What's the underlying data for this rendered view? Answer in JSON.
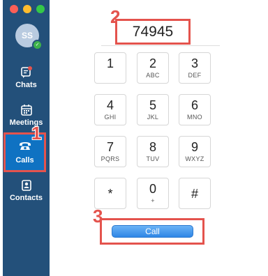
{
  "sidebar": {
    "avatar_initials": "SS",
    "items": [
      {
        "id": "chats",
        "label": "Chats",
        "icon": "chat-icon"
      },
      {
        "id": "meetings",
        "label": "Meetings",
        "icon": "calendar-icon"
      },
      {
        "id": "calls",
        "label": "Calls",
        "icon": "phone-icon",
        "active": true
      },
      {
        "id": "contacts",
        "label": "Contacts",
        "icon": "contacts-icon"
      }
    ]
  },
  "dialer": {
    "number": "74945",
    "keys": [
      {
        "digit": "1",
        "letters": ""
      },
      {
        "digit": "2",
        "letters": "ABC"
      },
      {
        "digit": "3",
        "letters": "DEF"
      },
      {
        "digit": "4",
        "letters": "GHI"
      },
      {
        "digit": "5",
        "letters": "JKL"
      },
      {
        "digit": "6",
        "letters": "MNO"
      },
      {
        "digit": "7",
        "letters": "PQRS"
      },
      {
        "digit": "8",
        "letters": "TUV"
      },
      {
        "digit": "9",
        "letters": "WXYZ"
      },
      {
        "digit": "*",
        "letters": ""
      },
      {
        "digit": "0",
        "letters": "+"
      },
      {
        "digit": "#",
        "letters": ""
      }
    ],
    "call_label": "Call"
  },
  "callouts": [
    "1",
    "2",
    "3"
  ],
  "colors": {
    "sidebar": "#23507a",
    "active_item": "#0f72c2",
    "callout": "#e4534d",
    "call_button": "#2f86e6"
  }
}
